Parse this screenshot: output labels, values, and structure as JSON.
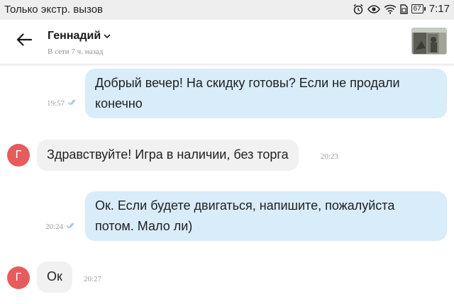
{
  "status_bar": {
    "left_text": "Только экстр. вызов",
    "battery": "67",
    "time": "7:17",
    "icons": [
      "alarm-icon",
      "eye-icon",
      "wifi-icon",
      "sim-icon",
      "battery-icon"
    ]
  },
  "header": {
    "contact_name": "Геннадий",
    "contact_status": "В сети 7 ч. назад",
    "icons": [
      "back-arrow-icon",
      "chevron-down-icon"
    ]
  },
  "messages": [
    {
      "direction": "outgoing",
      "text_line1": "Добрый вечер! На скидку готовы? Если не продали",
      "text_line2": "конечно",
      "time": "19:57",
      "read": true
    },
    {
      "direction": "incoming",
      "avatar_letter": "Г",
      "text": "Здравствуйте! Игра в наличии, без торга",
      "time": "20:23"
    },
    {
      "direction": "outgoing",
      "text_line1": "Ок. Если будете двигаться, напишите, пожалуйста",
      "text_line2": "потом. Мало ли)",
      "time": "20:24",
      "read": true
    },
    {
      "direction": "incoming",
      "avatar_letter": "Г",
      "text": "Ок",
      "time": "20:27"
    }
  ],
  "colors": {
    "outgoing_bubble": "#d8ecf9",
    "incoming_bubble": "#f1f1f1",
    "avatar": "#e65c5c",
    "read_check": "#9db8cc"
  }
}
